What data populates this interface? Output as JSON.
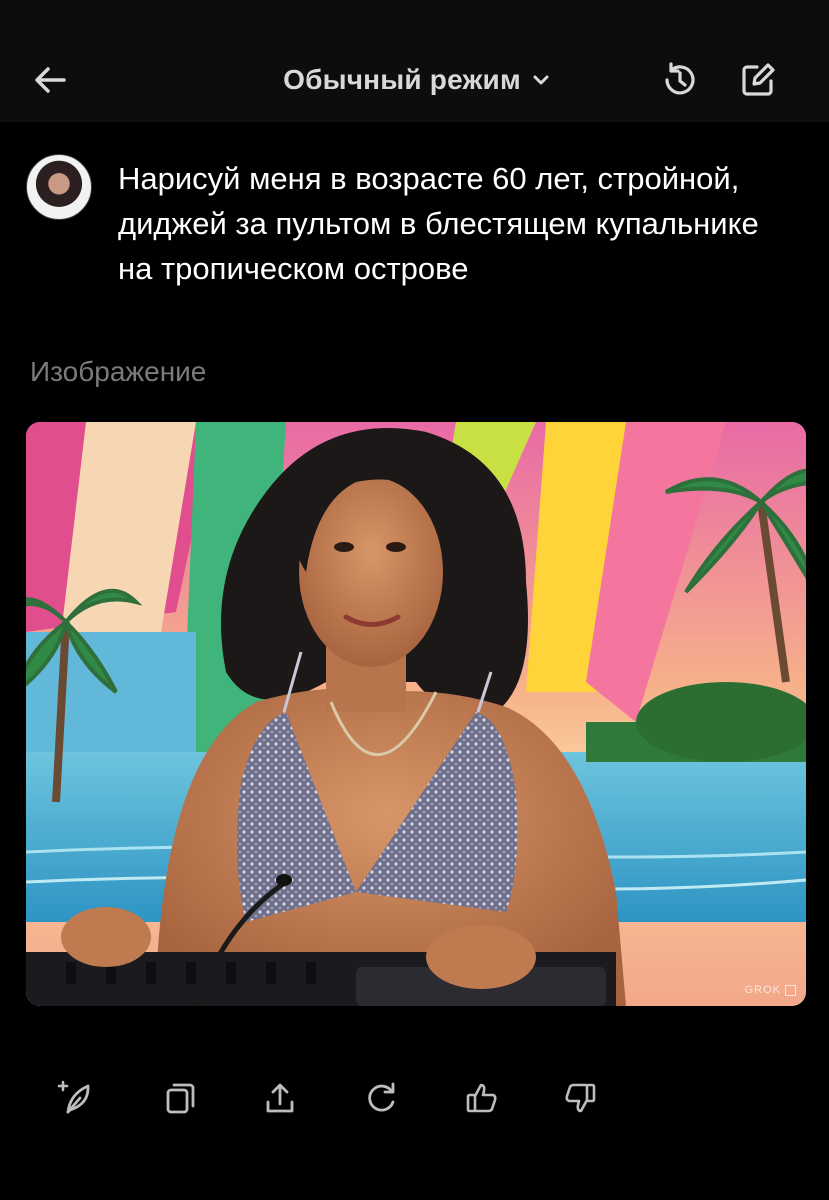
{
  "header": {
    "mode_label": "Обычный режим",
    "back_icon": "arrow-left-icon",
    "mode_icon": "chevron-down-icon",
    "history_icon": "history-icon",
    "edit_icon": "edit-icon"
  },
  "message": {
    "text": "Нарисуй меня в возрасте 60 лет, стройной, диджей за пультом в блестящем купальнике на тропическом острове"
  },
  "result": {
    "section_label": "Изображение",
    "watermark": "GROK"
  },
  "actions": [
    {
      "name": "regenerate-style",
      "icon": "sparkle-leaf-icon"
    },
    {
      "name": "copy",
      "icon": "copy-icon"
    },
    {
      "name": "share",
      "icon": "share-icon"
    },
    {
      "name": "regenerate",
      "icon": "refresh-icon"
    },
    {
      "name": "like",
      "icon": "thumbs-up-icon"
    },
    {
      "name": "dislike",
      "icon": "thumbs-down-icon"
    }
  ],
  "colors": {
    "background": "#000000",
    "header_bg": "#0d0d0d",
    "text": "#ffffff",
    "muted": "#7b7b7b",
    "icon": "#bdbdbd"
  }
}
